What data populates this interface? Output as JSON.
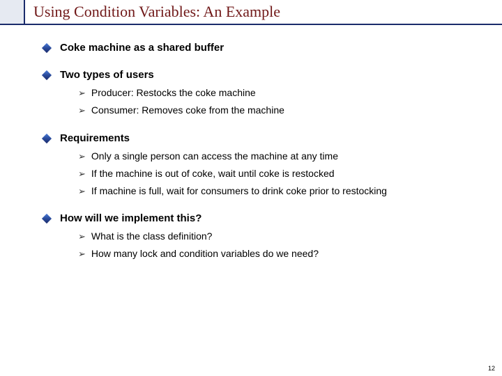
{
  "title": "Using Condition Variables: An Example",
  "sections": [
    {
      "label": "Coke machine as a shared buffer",
      "subs": []
    },
    {
      "label": "Two types of users",
      "subs": [
        "Producer: Restocks the coke machine",
        "Consumer: Removes coke from the machine"
      ]
    },
    {
      "label": "Requirements",
      "subs": [
        "Only a single person can access the machine at any time",
        "If the machine is out of coke, wait until coke is restocked",
        "If machine is full, wait for consumers to drink coke prior to restocking"
      ]
    },
    {
      "label": "How will we implement this?",
      "subs": [
        "What is the class definition?",
        "How many lock and condition variables do we need?"
      ]
    }
  ],
  "page_number": "12"
}
